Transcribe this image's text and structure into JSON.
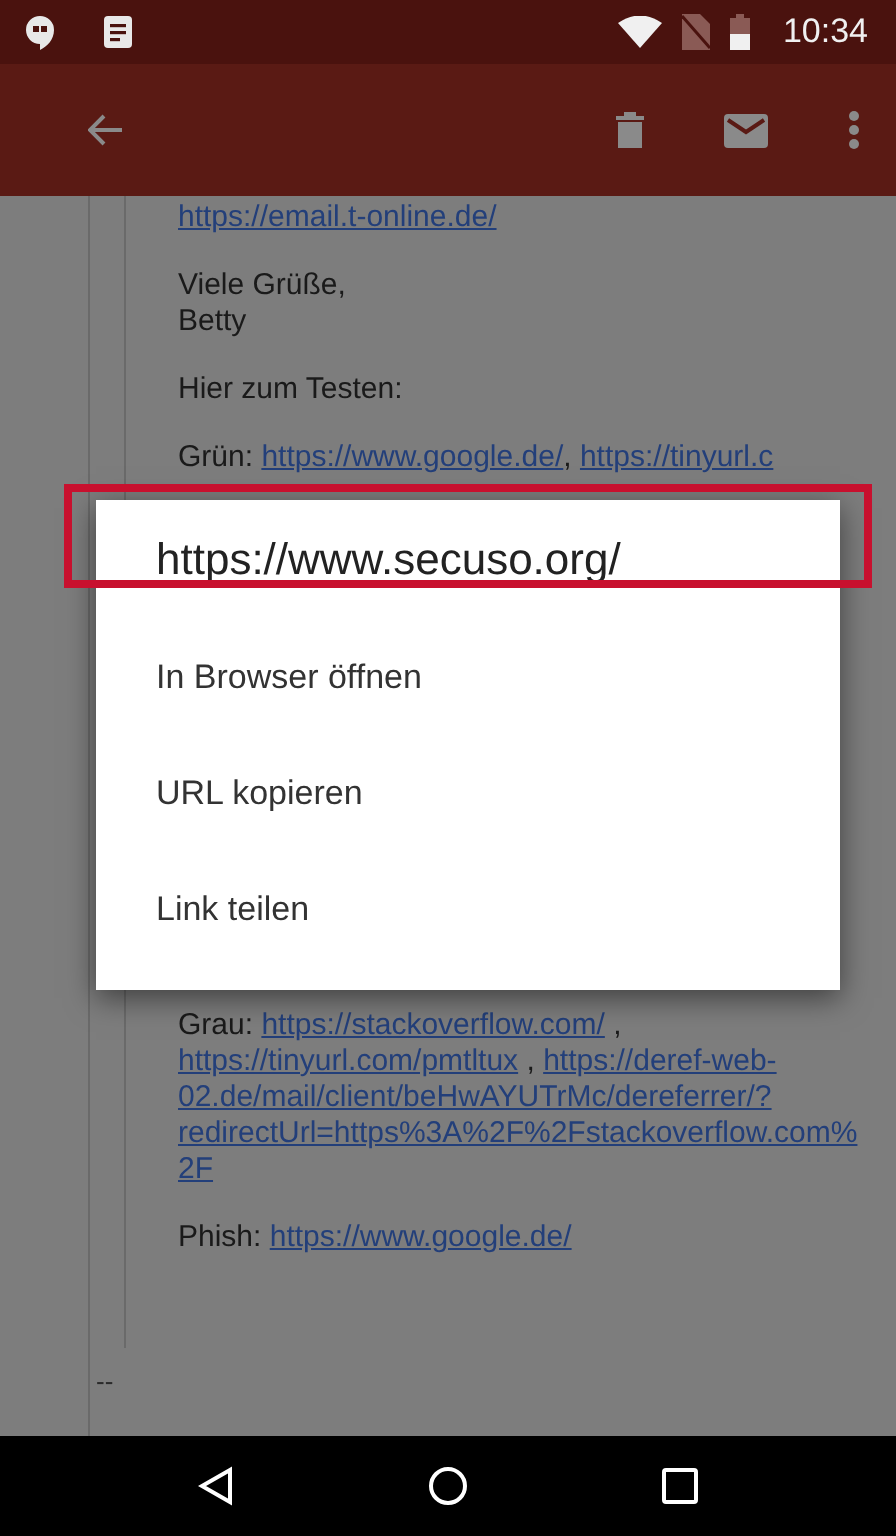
{
  "status_bar": {
    "time": "10:34"
  },
  "email": {
    "above_dialog": [
      {
        "lines": [
          [
            {
              "text": "https://email.t-online.de/",
              "link": true
            }
          ]
        ]
      },
      {
        "lines": [
          [
            {
              "text": "Viele Grüße,",
              "link": false
            }
          ],
          [
            {
              "text": "Betty",
              "link": false
            }
          ]
        ]
      },
      {
        "lines": [
          [
            {
              "text": "Hier zum Testen:",
              "link": false
            }
          ]
        ]
      },
      {
        "lines": [
          [
            {
              "text": "Grün: ",
              "link": false
            },
            {
              "text": "https://www.google.de/",
              "link": true
            },
            {
              "text": ", ",
              "link": false
            },
            {
              "text": "https://tinyurl.c",
              "link": true
            }
          ]
        ]
      }
    ],
    "below_dialog": [
      {
        "lines": [
          [
            {
              "text": "Grau: ",
              "link": false
            },
            {
              "text": "https://stackoverflow.com/",
              "link": true
            },
            {
              "text": " ,",
              "link": false
            }
          ],
          [
            {
              "text": "https://tinyurl.com/pmtltux",
              "link": true
            },
            {
              "text": " , ",
              "link": false
            },
            {
              "text": "https://deref-web-",
              "link": true
            }
          ],
          [
            {
              "text": "02.de/mail/client/beHwAYUTrMc/dereferrer/?",
              "link": true
            }
          ],
          [
            {
              "text": "redirectUrl=https%3A%2F%2Fstackoverflow.com%",
              "link": true
            }
          ],
          [
            {
              "text": "2F",
              "link": true
            }
          ]
        ]
      },
      {
        "lines": [
          [
            {
              "text": "Phish: ",
              "link": false
            },
            {
              "text": "https://www.google.de/",
              "link": true
            }
          ]
        ]
      }
    ],
    "signature_mark": "--"
  },
  "dialog": {
    "title": "https://www.secuso.org/",
    "title_highlighted": true,
    "items": [
      {
        "label": "In Browser öffnen"
      },
      {
        "label": "URL kopieren"
      },
      {
        "label": "Link teilen"
      }
    ]
  }
}
